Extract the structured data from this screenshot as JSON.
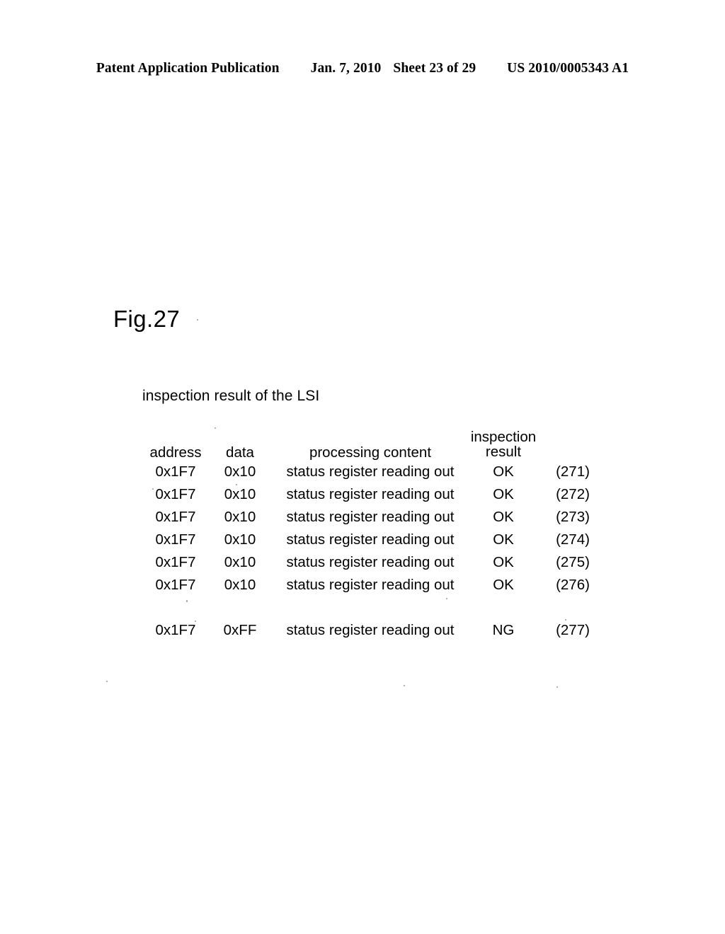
{
  "page_header": {
    "publication": "Patent Application Publication",
    "date": "Jan. 7, 2010",
    "sheet": "Sheet 23 of 29",
    "document_number": "US 2010/0005343 A1"
  },
  "figure": {
    "label": "Fig.27",
    "caption": "inspection result of the LSI"
  },
  "table": {
    "headers": {
      "address": "address",
      "data": "data",
      "processing_content": "processing content",
      "inspection_result_line1": "inspection",
      "inspection_result_line2": "result",
      "reference": ""
    },
    "rows": [
      {
        "address": "0x1F7",
        "data": "0x10",
        "processing_content": "status register reading out",
        "inspection_result": "OK",
        "reference": "(271)"
      },
      {
        "address": "0x1F7",
        "data": "0x10",
        "processing_content": "status register reading out",
        "inspection_result": "OK",
        "reference": "(272)"
      },
      {
        "address": "0x1F7",
        "data": "0x10",
        "processing_content": "status register reading out",
        "inspection_result": "OK",
        "reference": "(273)"
      },
      {
        "address": "0x1F7",
        "data": "0x10",
        "processing_content": "status register reading out",
        "inspection_result": "OK",
        "reference": "(274)"
      },
      {
        "address": "0x1F7",
        "data": "0x10",
        "processing_content": "status register reading out",
        "inspection_result": "OK",
        "reference": "(275)"
      },
      {
        "address": "0x1F7",
        "data": "0x10",
        "processing_content": "status register reading out",
        "inspection_result": "OK",
        "reference": "(276)"
      }
    ],
    "final_row": {
      "address": "0x1F7",
      "data": "0xFF",
      "processing_content": "status register reading out",
      "inspection_result": "NG",
      "reference": "(277)"
    }
  },
  "colors": {
    "ink": "#000000",
    "paper": "#ffffff"
  }
}
